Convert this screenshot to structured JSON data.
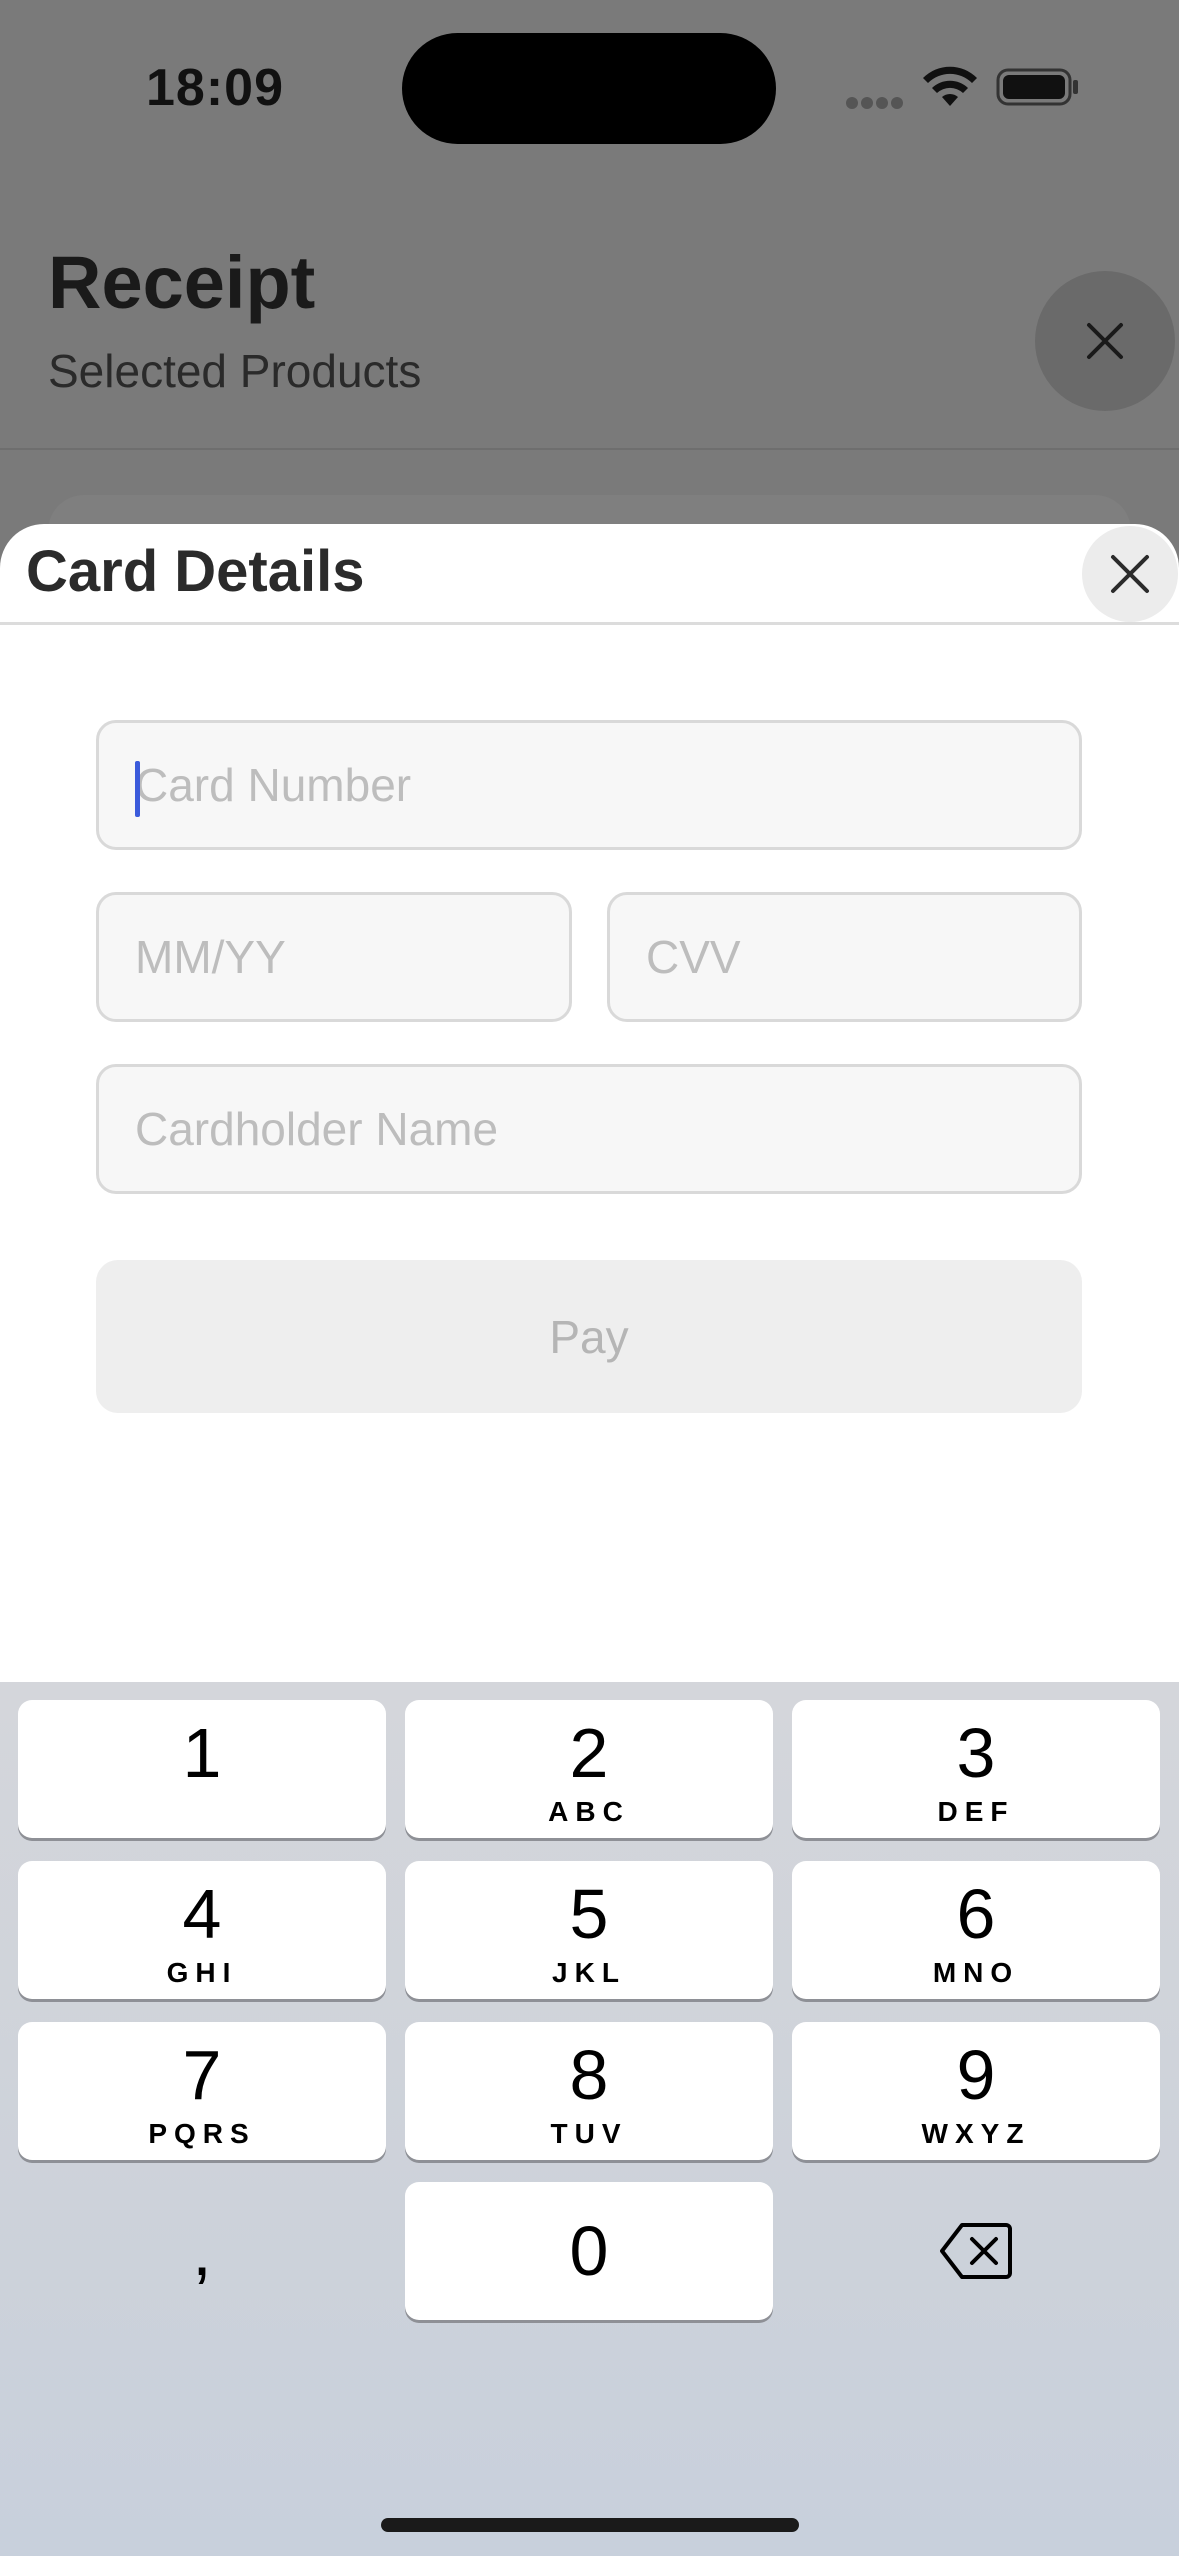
{
  "status_bar": {
    "time": "18:09"
  },
  "background": {
    "title": "Receipt",
    "subtitle": "Selected Products"
  },
  "sheet": {
    "title": "Card Details",
    "fields": {
      "card_number_placeholder": "Card Number",
      "expiry_placeholder": "MM/YY",
      "cvv_placeholder": "CVV",
      "cardholder_placeholder": "Cardholder Name"
    },
    "pay_label": "Pay"
  },
  "keyboard": {
    "keys": [
      {
        "num": "1",
        "letters": ""
      },
      {
        "num": "2",
        "letters": "ABC"
      },
      {
        "num": "3",
        "letters": "DEF"
      },
      {
        "num": "4",
        "letters": "GHI"
      },
      {
        "num": "5",
        "letters": "JKL"
      },
      {
        "num": "6",
        "letters": "MNO"
      },
      {
        "num": "7",
        "letters": "PQRS"
      },
      {
        "num": "8",
        "letters": "TUV"
      },
      {
        "num": "9",
        "letters": "WXYZ"
      },
      {
        "num": "0",
        "letters": ""
      }
    ],
    "comma": ","
  },
  "colors": {
    "accent_caret": "#3b5bdb",
    "sheet_background": "#ffffff",
    "dim_overlay": "#7a7a7a"
  }
}
